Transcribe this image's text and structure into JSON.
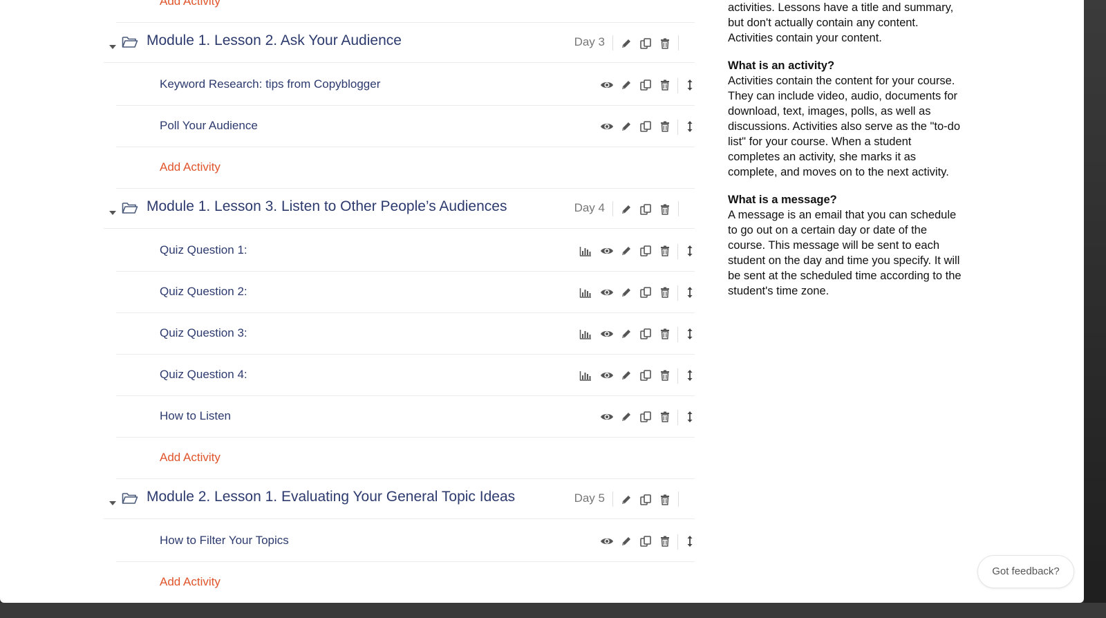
{
  "lessons": [
    {
      "title": "Module 1. Lesson 2. Ask Your Audience",
      "day": "Day 3",
      "activities": [
        {
          "title": "Keyword Research: tips from Copyblogger",
          "has_stats": false
        },
        {
          "title": "Poll Your Audience",
          "has_stats": false
        }
      ],
      "add_label": "Add Activity"
    },
    {
      "title": "Module 1. Lesson 3. Listen to Other People’s Audiences",
      "day": "Day 4",
      "activities": [
        {
          "title": "Quiz Question 1:",
          "has_stats": true
        },
        {
          "title": "Quiz Question 2:",
          "has_stats": true
        },
        {
          "title": "Quiz Question 3:",
          "has_stats": true
        },
        {
          "title": "Quiz Question 4:",
          "has_stats": true
        },
        {
          "title": "How to Listen",
          "has_stats": false
        }
      ],
      "add_label": "Add Activity"
    },
    {
      "title": "Module 2. Lesson 1. Evaluating Your General Topic Ideas",
      "day": "Day 5",
      "activities": [
        {
          "title": "How to Filter Your Topics",
          "has_stats": false
        }
      ],
      "add_label": "Add Activity"
    }
  ],
  "top_add_label": "Add Activity",
  "help": {
    "intro_lines": [
      "activities. Lessons have a title and summary,",
      "but don't actually contain any content.",
      "Activities contain your content."
    ],
    "activity_heading": "What is an activity?",
    "activity_lines": [
      "Activities contain the content for your course.",
      "They can include video, audio, documents for",
      "download, text, images, polls, as well as",
      "discussions. Activities also serve as the \"to-do",
      "list\" for your course. When a student",
      "completes an activity, she marks it as",
      "complete, and moves on to the next activity."
    ],
    "message_heading": "What is a message?",
    "message_lines": [
      "A message is an email that you can schedule",
      "to go out on a certain day or date of the",
      "course. This message will be sent to each",
      "student on the day and time you specify. It will",
      "be sent at the scheduled time according to the",
      "student's time zone."
    ]
  },
  "feedback_label": "Got feedback?",
  "colors": {
    "title": "#2c3a6e",
    "add_activity": "#e0542b",
    "icon": "#555555"
  }
}
